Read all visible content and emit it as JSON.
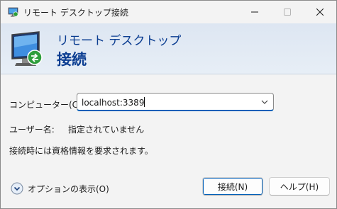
{
  "window": {
    "title": "リモート デスクトップ接続"
  },
  "header": {
    "line1": "リモート デスクトップ",
    "line2": "接続"
  },
  "form": {
    "computer_label": "コンピューター(C):",
    "computer_value": "localhost:3389",
    "user_label": "ユーザー名:",
    "user_value": "指定されていません",
    "note": "接続時には資格情報を要求されます。"
  },
  "footer": {
    "options_label": "オプションの表示(O)",
    "connect_label": "接続(N)",
    "help_label": "ヘルプ(H)"
  },
  "colors": {
    "header_text": "#0b3d91",
    "accent": "#005fb8",
    "window_bg": "#f3f3f3"
  }
}
